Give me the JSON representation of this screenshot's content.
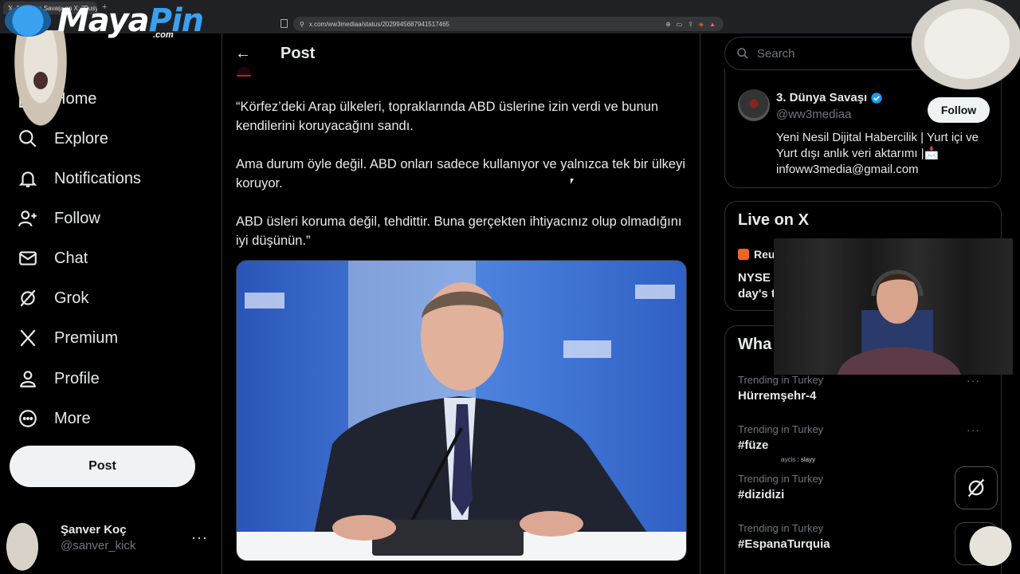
{
  "browser": {
    "tab_title": "3. Dünya Savaşı on X: \"Rusy...",
    "url": "x.com/ww3mediaa/status/2029945687941517465",
    "colors": {
      "chrome_bg": "#202124",
      "tab_bg": "#35363a"
    }
  },
  "overlay": {
    "logo_main": "Maya",
    "logo_accent": "Pin",
    "logo_suffix": ".com",
    "chat_user": "aycis",
    "chat_message": "slayy"
  },
  "sidebar": {
    "items": [
      {
        "label": "Home",
        "icon": "home-icon"
      },
      {
        "label": "Explore",
        "icon": "search-icon"
      },
      {
        "label": "Notifications",
        "icon": "bell-icon"
      },
      {
        "label": "Follow",
        "icon": "add-user-icon"
      },
      {
        "label": "Chat",
        "icon": "mail-icon"
      },
      {
        "label": "Grok",
        "icon": "grok-icon"
      },
      {
        "label": "Premium",
        "icon": "x-logo-icon"
      },
      {
        "label": "Profile",
        "icon": "person-icon"
      },
      {
        "label": "More",
        "icon": "more-circle-icon"
      }
    ],
    "post_button": "Post",
    "account": {
      "name": "Şanver Koç",
      "handle": "@sanver_kick"
    }
  },
  "main": {
    "header_title": "Post",
    "tweet_paragraphs": [
      "“Körfez’deki Arap ülkeleri, topraklarında ABD üslerine izin verdi ve bunun kendilerini koruyacağını sandı.",
      "Ama durum öyle değil. ABD onları sadece kullanıyor ve yalnızca tek bir ülkeyi koruyor.",
      "ABD üsleri koruma değil, tehdittir. Buna gerçekten ihtiyacınız olup olmadığını iyi düşünün.”"
    ]
  },
  "right": {
    "search_placeholder": "Search",
    "profile_card": {
      "name": "3. Dünya Savaşı",
      "handle": "@ww3mediaa",
      "bio": "Yeni Nesil Dijital Habercilik | Yurt içi ve Yurt dışı anlık veri aktarımı |📩 infoww3media@gmail.com",
      "follow_label": "Follow"
    },
    "live": {
      "title": "Live on X",
      "source": "Reu",
      "headline_line1": "NYSE o",
      "headline_line2": "day's t"
    },
    "trends": {
      "title": "Wha",
      "items": [
        {
          "meta": "Trending in Turkey",
          "name": "Hürremşehr-4"
        },
        {
          "meta": "Trending in Turkey",
          "name": "#füze"
        },
        {
          "meta": "Trending in Turkey",
          "name": "#dizidizi"
        },
        {
          "meta": "Trending in Turkey",
          "name": "#EspanaTurquia"
        }
      ]
    }
  },
  "colors": {
    "background": "#000000",
    "text_primary": "#e7e9ea",
    "text_secondary": "#71767b",
    "border": "#2f3336",
    "verified": "#1d9bf0",
    "button_light": "#eff3f4"
  }
}
